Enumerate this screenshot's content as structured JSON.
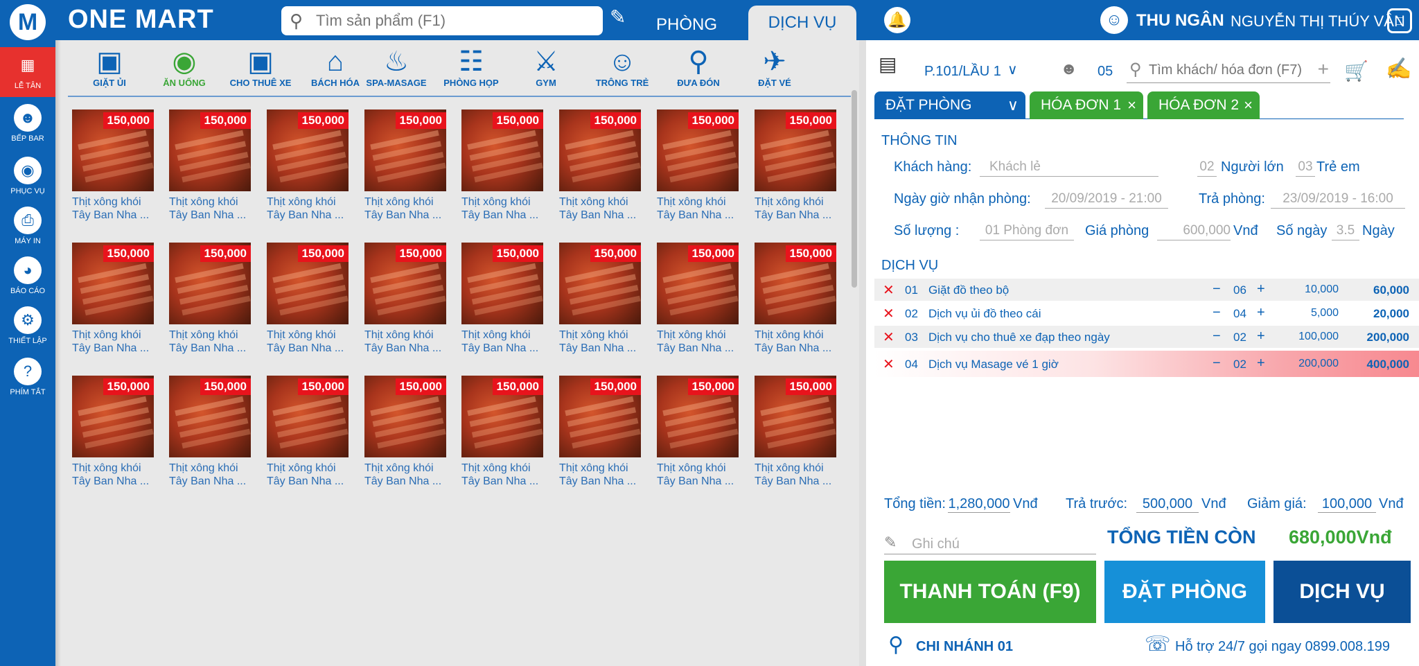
{
  "brand": {
    "logo": "M",
    "name": "ONE MART"
  },
  "search": {
    "placeholder": "Tìm sản phẩm (F1)"
  },
  "top_tabs": [
    {
      "label": "PHÒNG"
    },
    {
      "label": "DỊCH VỤ"
    }
  ],
  "user": {
    "role": "THU NGÂN",
    "name": "NGUYỄN THỊ THÚY VÂN"
  },
  "sidebar": [
    {
      "label": "LỄ TÂN",
      "icon": "building-icon"
    },
    {
      "label": "BẾP BAR",
      "icon": "chef-icon"
    },
    {
      "label": "PHỤC VỤ",
      "icon": "cloche-icon"
    },
    {
      "label": "MÁY IN",
      "icon": "printer-icon"
    },
    {
      "label": "BÁO CÁO",
      "icon": "chart-icon"
    },
    {
      "label": "THIẾT LẬP",
      "icon": "gear-icon"
    },
    {
      "label": "PHÍM TẮT",
      "icon": "question-icon"
    }
  ],
  "categories": [
    {
      "label": "GIẶT ỦI",
      "icon": "washer-icon"
    },
    {
      "label": "ĂN UỐNG",
      "icon": "dining-icon"
    },
    {
      "label": "CHO THUÊ XE",
      "icon": "car-icon"
    },
    {
      "label": "BÁCH HÓA",
      "icon": "store-icon"
    },
    {
      "label": "SPA-MASAGE",
      "icon": "spa-icon"
    },
    {
      "label": "PHÒNG HỌP",
      "icon": "meeting-icon"
    },
    {
      "label": "GYM",
      "icon": "gym-icon"
    },
    {
      "label": "TRÔNG TRẺ",
      "icon": "baby-icon"
    },
    {
      "label": "ĐƯA ĐÓN",
      "icon": "location-icon"
    },
    {
      "label": "ĐẶT VÉ",
      "icon": "plane-icon"
    }
  ],
  "product": {
    "price": "150,000",
    "name_line1": "Thịt xông khói",
    "name_line2": "Tây Ban Nha ..."
  },
  "room": {
    "label": "P.101/LẦU 1",
    "guests": "05",
    "search_placeholder": "Tìm khách/ hóa đơn (F7)"
  },
  "right_tabs": [
    {
      "label": "ĐẶT PHÒNG"
    },
    {
      "label": "HÓA ĐƠN 1"
    },
    {
      "label": "HÓA ĐƠN 2"
    }
  ],
  "info": {
    "section": "THÔNG TIN",
    "customer_label": "Khách hàng:",
    "customer_placeholder": "Khách lẻ",
    "adults": "02",
    "adults_label": "Người lớn",
    "children": "03",
    "children_label": "Trẻ em",
    "checkin_label": "Ngày giờ nhận phòng:",
    "checkin": "20/09/2019 - 21:00",
    "checkout_label": "Trả phòng:",
    "checkout": "23/09/2019 - 16:00",
    "qty_label": "Số lượng :",
    "qty": "01 Phòng đơn",
    "price_label": "Giá phòng",
    "price": "600,000",
    "currency": "Vnđ",
    "days_label": "Số ngày",
    "days": "3.5",
    "days_unit": "Ngày"
  },
  "services": {
    "section": "DỊCH VỤ",
    "items": [
      {
        "no": "01",
        "name": "Giặt đồ theo bộ",
        "qty": "06",
        "price": "10,000",
        "total": "60,000"
      },
      {
        "no": "02",
        "name": "Dịch vụ ủi đồ theo cái",
        "qty": "04",
        "price": "5,000",
        "total": "20,000"
      },
      {
        "no": "03",
        "name": "Dịch vụ cho thuê xe đạp theo ngày",
        "qty": "02",
        "price": "100,000",
        "total": "200,000"
      },
      {
        "no": "04",
        "name": "Dịch vụ Masage vé 1 giờ",
        "qty": "02",
        "price": "200,000",
        "total": "400,000"
      }
    ]
  },
  "totals": {
    "total_label": "Tổng tiền:",
    "total": "1,280,000",
    "total_unit": "Vnđ",
    "prepaid_label": "Trả trước:",
    "prepaid": "500,000",
    "prepaid_unit": "Vnđ",
    "discount_label": "Giảm giá:",
    "discount": "100,000",
    "discount_unit": "Vnđ",
    "note_placeholder": "Ghi chú",
    "remaining_label": "TỔNG TIỀN CÒN",
    "remaining": "680,000Vnđ"
  },
  "buttons": {
    "pay": "THANH TOÁN (F9)",
    "book": "ĐẶT PHÒNG",
    "service": "DỊCH VỤ"
  },
  "footer": {
    "branch": "CHI NHÁNH 01",
    "support": "Hỗ trợ 24/7 gọi ngay 0899.008.199"
  },
  "colors": {
    "primary": "#0d63b5",
    "green": "#3aa636",
    "red": "#e8131c",
    "sky": "#1690d8",
    "navy": "#0b4f96"
  }
}
